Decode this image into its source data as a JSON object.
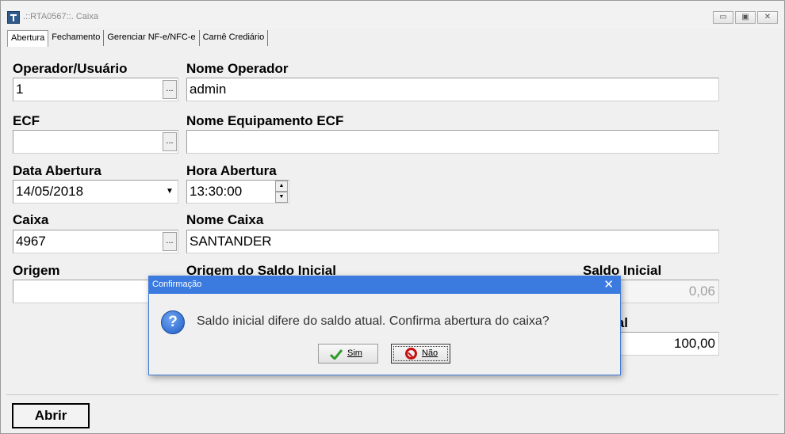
{
  "window": {
    "title": ".::RTA0567::. Caixa",
    "minimize_glyph": "▭",
    "maximize_glyph": "▣",
    "close_glyph": "✕"
  },
  "tabs": [
    {
      "label": "Abertura"
    },
    {
      "label": "Fechamento"
    },
    {
      "label": "Gerenciar NF-e/NFC-e"
    },
    {
      "label": "Carnê Crediário"
    }
  ],
  "form": {
    "operador_label": "Operador/Usuário",
    "operador_value": "1",
    "nome_operador_label": "Nome Operador",
    "nome_operador_value": "admin",
    "ecf_label": "ECF",
    "ecf_value": "",
    "nome_ecf_label": "Nome Equipamento ECF",
    "nome_ecf_value": "",
    "data_abertura_label": "Data Abertura",
    "data_abertura_value": "14/05/2018",
    "hora_abertura_label": "Hora Abertura",
    "hora_abertura_value": "13:30:00",
    "caixa_label": "Caixa",
    "caixa_value": "4967",
    "nome_caixa_label": "Nome Caixa",
    "nome_caixa_value": "SANTANDER",
    "origem_label": "Origem",
    "origem_value": "",
    "origem_saldo_label": "Origem do Saldo Inicial",
    "saldo_inicial_label": "Saldo Inicial",
    "saldo_inicial_value": "0,06",
    "saldo_atual_label": "o Atual",
    "saldo_atual_value": "100,00",
    "ellipsis": "..."
  },
  "footer": {
    "abrir_label": "Abrir"
  },
  "dialog": {
    "title": "Confirmação",
    "close_glyph": "✕",
    "question_glyph": "?",
    "message": "Saldo inicial difere do saldo atual. Confirma abertura do caixa?",
    "sim_label": "Sim",
    "nao_label": "Não"
  },
  "colors": {
    "dialog_titlebar": "#3b7be0",
    "check_green": "#2e9a2e",
    "no_red": "#c41010"
  }
}
